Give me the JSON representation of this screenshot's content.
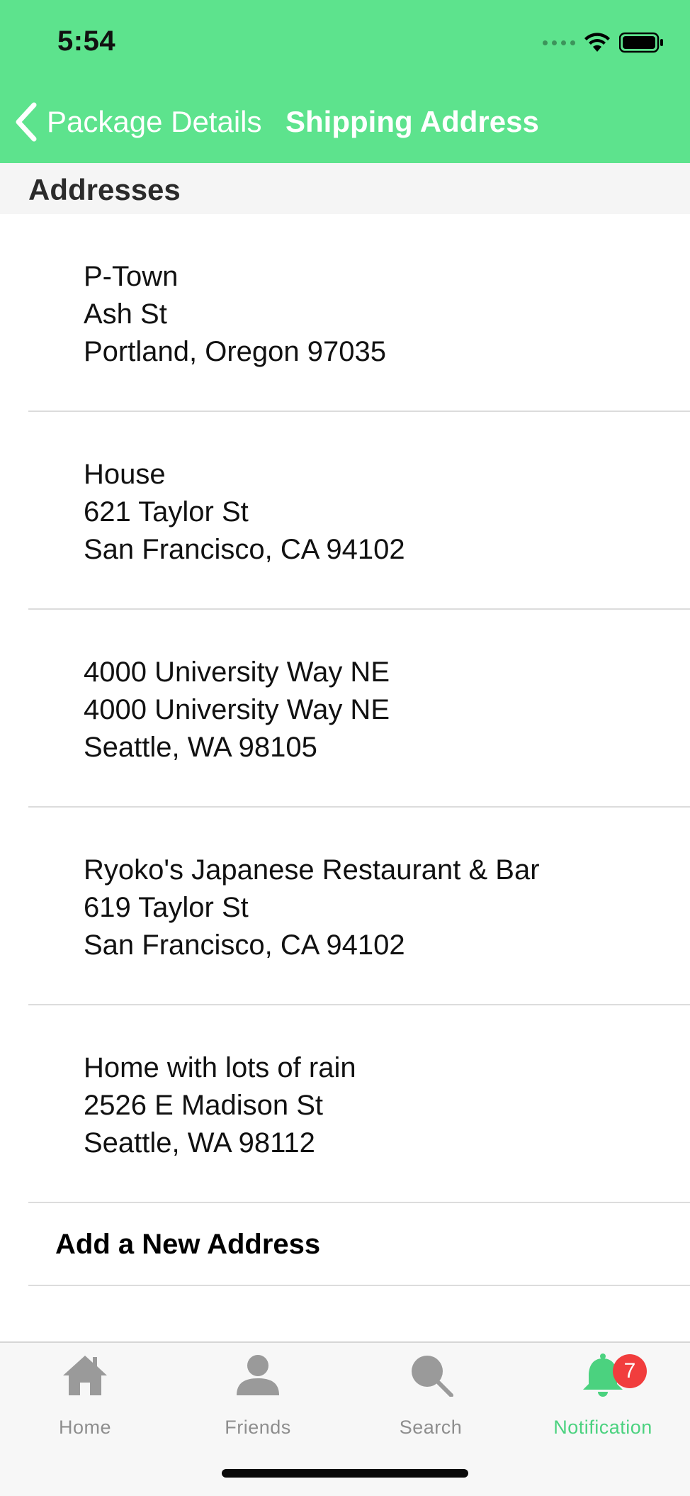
{
  "status_bar": {
    "time": "5:54"
  },
  "nav": {
    "back_label": "Package Details",
    "title": "Shipping Address"
  },
  "section": {
    "title": "Addresses"
  },
  "addresses": [
    {
      "line1": "P-Town",
      "line2": "Ash St",
      "line3": "Portland, Oregon 97035"
    },
    {
      "line1": "House",
      "line2": "621 Taylor St",
      "line3": "San Francisco, CA 94102"
    },
    {
      "line1": "4000 University Way NE",
      "line2": "4000 University Way NE",
      "line3": "Seattle, WA 98105"
    },
    {
      "line1": "Ryoko's Japanese Restaurant & Bar",
      "line2": "619 Taylor St",
      "line3": "San Francisco, CA 94102"
    },
    {
      "line1": "Home with lots of rain",
      "line2": "2526 E Madison St",
      "line3": "Seattle, WA 98112"
    }
  ],
  "add_address_label": "Add a New Address",
  "tabbar": {
    "tabs": [
      {
        "label": "Home",
        "icon": "house-icon"
      },
      {
        "label": "Friends",
        "icon": "person-icon"
      },
      {
        "label": "Search",
        "icon": "magnifier-icon"
      },
      {
        "label": "Notification",
        "icon": "bell-icon",
        "badge": "7",
        "active": true
      }
    ]
  },
  "colors": {
    "header_green": "#5de38d",
    "active_tab": "#4bd27f",
    "badge_red": "#f13d3d",
    "inactive_tab": "#8e8e8e"
  }
}
